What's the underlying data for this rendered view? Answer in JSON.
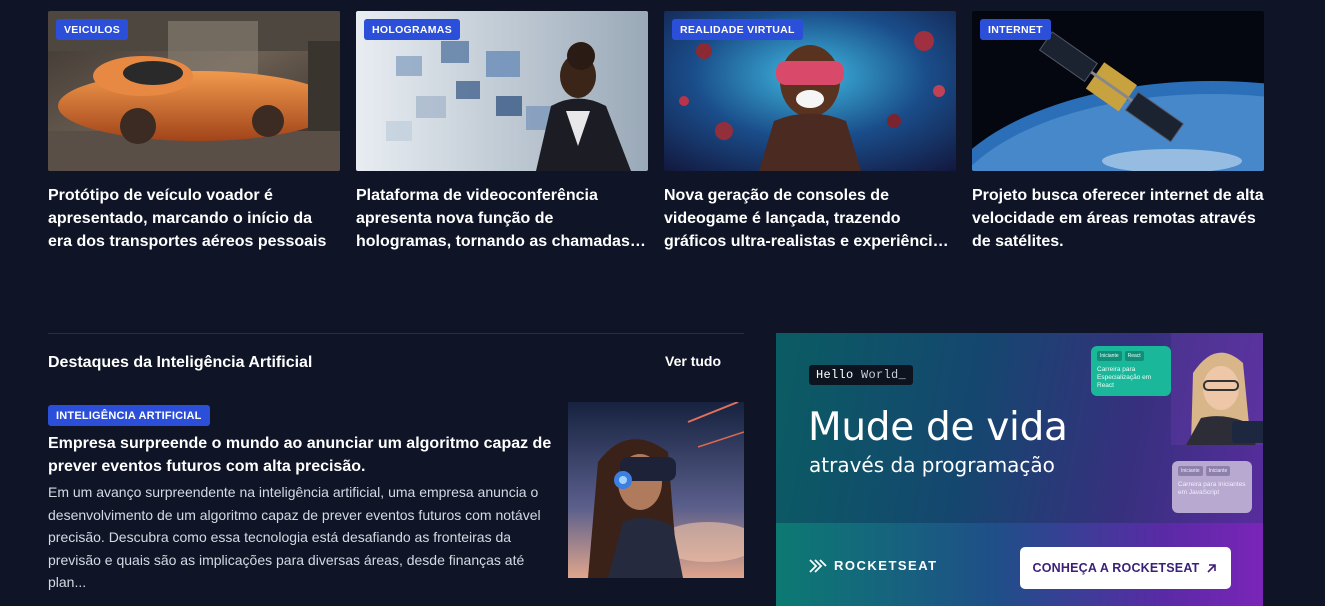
{
  "cards": [
    {
      "tag": "VEICULOS",
      "title": "Protótipo de veículo voador é apresentado, marcando o início da era dos transportes aéreos pessoais"
    },
    {
      "tag": "HOLOGRAMAS",
      "title": "Plataforma de videoconferência apresenta nova função de hologramas, tornando as chamadas mais imersivas"
    },
    {
      "tag": "REALIDADE VIRTUAL",
      "title": "Nova geração de consoles de videogame é lançada, trazendo gráficos ultra-realistas e experiências imersivas"
    },
    {
      "tag": "INTERNET",
      "title": "Projeto busca oferecer internet de alta velocidade em áreas remotas através de satélites."
    }
  ],
  "section": {
    "title": "Destaques da Inteligência Artificial",
    "see_all": "Ver tudo"
  },
  "featured": {
    "tag": "INTELIGÊNCIA ARTIFICIAL",
    "title": "Empresa surpreende o mundo ao anunciar um algoritmo capaz de prever eventos futuros com alta precisão.",
    "excerpt": "Em um avanço surpreendente na inteligência artificial, uma empresa anuncia o desenvolvimento de um algoritmo capaz de prever eventos futuros com notável precisão. Descubra como essa tecnologia está desafiando as fronteiras da previsão e quais são as implicações para diversas áreas, desde finanças até plan..."
  },
  "ad": {
    "hello": "Hello",
    "world": "World_",
    "headline": "Mude de vida",
    "subheadline": "através da programação",
    "brand": "ROCKETSEAT",
    "cta": "CONHEÇA A ROCKETSEAT",
    "card1_tags": [
      "Iniciante",
      "React"
    ],
    "card1_text": "Carreira para Especialização em React",
    "card2_tags": [
      "Iniciante",
      "Iniciante"
    ],
    "card2_text": "Carreira para Iniciantes em JavaScript"
  },
  "colors": {
    "background": "#0f1526",
    "badge": "#2b4fd8"
  }
}
